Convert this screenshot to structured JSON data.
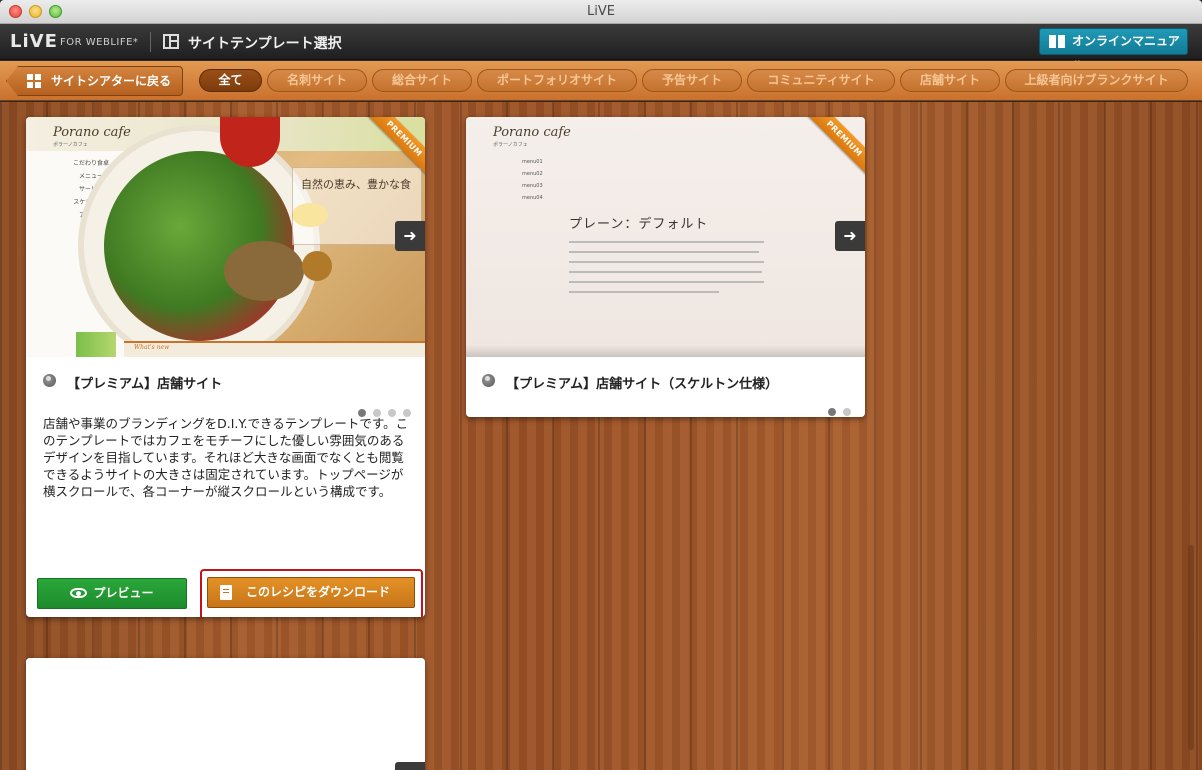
{
  "window": {
    "title": "LiVE"
  },
  "header": {
    "logo": "LiVE",
    "logo_sub": "FOR WEBLIFE*",
    "page_title": "サイトテンプレート選択",
    "manual_button": "オンラインマニュアル"
  },
  "filters": {
    "back_label": "サイトシアターに戻る",
    "pills": [
      "全て",
      "名刺サイト",
      "総合サイト",
      "ポートフォリオサイト",
      "予告サイト",
      "コミュニティサイト",
      "店舗サイト",
      "上級者向けブランクサイト"
    ],
    "active": "全て"
  },
  "cards": [
    {
      "title": "【プレミアム】店舗サイト",
      "ribbon": "PREMIUM",
      "thumb_logo": "Porano cafe",
      "thumb_logo_sub": "ポラーノカフェ",
      "thumb_menu": [
        "こだわり食卓",
        "メニュー",
        "サービス",
        "スケジュール",
        "アクセス"
      ],
      "thumb_heading": "自然の恵み、豊かな食",
      "thumb_footer_heading": "What's new",
      "description": "店舗や事業のブランディングをD.I.Y.できるテンプレートです。このテンプレートではカフェをモチーフにした優しい雰囲気のあるデザインを目指しています。それほど大きな画面でなくとも閲覧できるようサイトの大きさは固定されています。トップページが横スクロールで、各コーナーが縦スクロールという構成です。",
      "preview_button": "プレビュー",
      "download_button": "このレシピをダウンロード",
      "slides": 4
    },
    {
      "title": "【プレミアム】店舗サイト（スケルトン仕様）",
      "ribbon": "PREMIUM",
      "thumb_logo": "Porano cafe",
      "thumb_logo_sub": "ポラーノカフェ",
      "thumb_menu": [
        "menu01",
        "menu02",
        "menu03",
        "menu04"
      ],
      "thumb_heading": "プレーン：デフォルト",
      "slides": 2
    }
  ],
  "colors": {
    "filter_bar": "#d98a45",
    "manual_button": "#1a8aa6",
    "preview_button": "#23a033",
    "download_button": "#d98620",
    "highlight": "#c0141a"
  }
}
